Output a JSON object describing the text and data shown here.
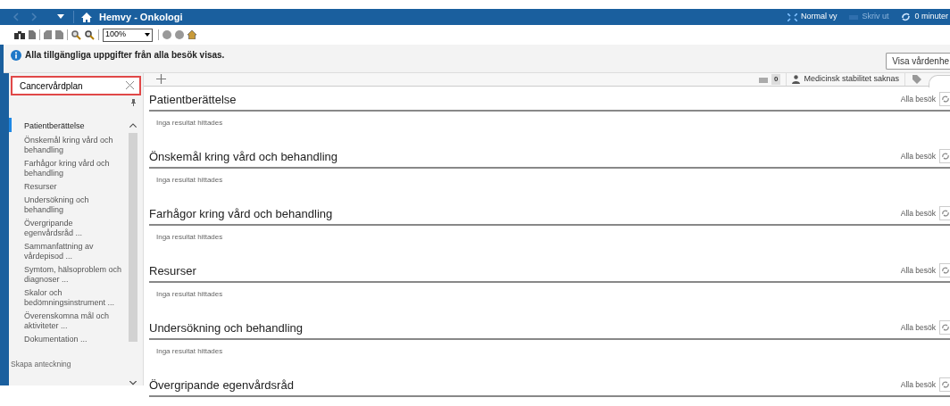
{
  "title_bar": {
    "title": "Hemvy - Onkologi",
    "actions": [
      {
        "kind": "normal",
        "label": "Normal vy",
        "disabled": false
      },
      {
        "kind": "print",
        "label": "Skriv ut",
        "disabled": true
      },
      {
        "kind": "refresh",
        "label": "0 minuter",
        "disabled": false
      }
    ]
  },
  "toolbar": {
    "zoom": "100%"
  },
  "info": {
    "message": "Alla tillgängliga uppgifter från alla besök visas.",
    "button": "Visa vårdenhe"
  },
  "search": {
    "value": "Cancervårdplan"
  },
  "status": {
    "count": "0",
    "stability": "Medicinsk stabilitet saknas"
  },
  "sidebar": {
    "items": [
      {
        "label": "Patientberättelse",
        "selected": true
      },
      {
        "label": "Önskemål kring vård och behandling",
        "selected": false
      },
      {
        "label": "Farhågor kring vård och behandling",
        "selected": false
      },
      {
        "label": "Resurser",
        "selected": false
      },
      {
        "label": "Undersökning och behandling",
        "selected": false
      },
      {
        "label": "Övergripande egenvårdsråd ...",
        "selected": false
      },
      {
        "label": "Sammanfattning av vårdepisod ...",
        "selected": false
      },
      {
        "label": "Symtom, hälsoproblem och diagnoser ...",
        "selected": false
      },
      {
        "label": "Skalor och bedömningsinstrument ...",
        "selected": false
      },
      {
        "label": "Överenskomna mål och aktiviteter ...",
        "selected": false
      },
      {
        "label": "Dokumentation ...",
        "selected": false
      }
    ],
    "footer": "Skapa anteckning"
  },
  "sections": [
    {
      "title": "Patientberättelse",
      "filter": "Alla besök",
      "result": "Inga resultat hittades"
    },
    {
      "title": "Önskemål kring vård och behandling",
      "filter": "Alla besök",
      "result": "Inga resultat hittades"
    },
    {
      "title": "Farhågor kring vård och behandling",
      "filter": "Alla besök",
      "result": "Inga resultat hittades"
    },
    {
      "title": "Resurser",
      "filter": "Alla besök",
      "result": "Inga resultat hittades"
    },
    {
      "title": "Undersökning och behandling",
      "filter": "Alla besök",
      "result": "Inga resultat hittades"
    },
    {
      "title": "Övergripande egenvårdsråd",
      "filter": "Alla besök"
    }
  ]
}
